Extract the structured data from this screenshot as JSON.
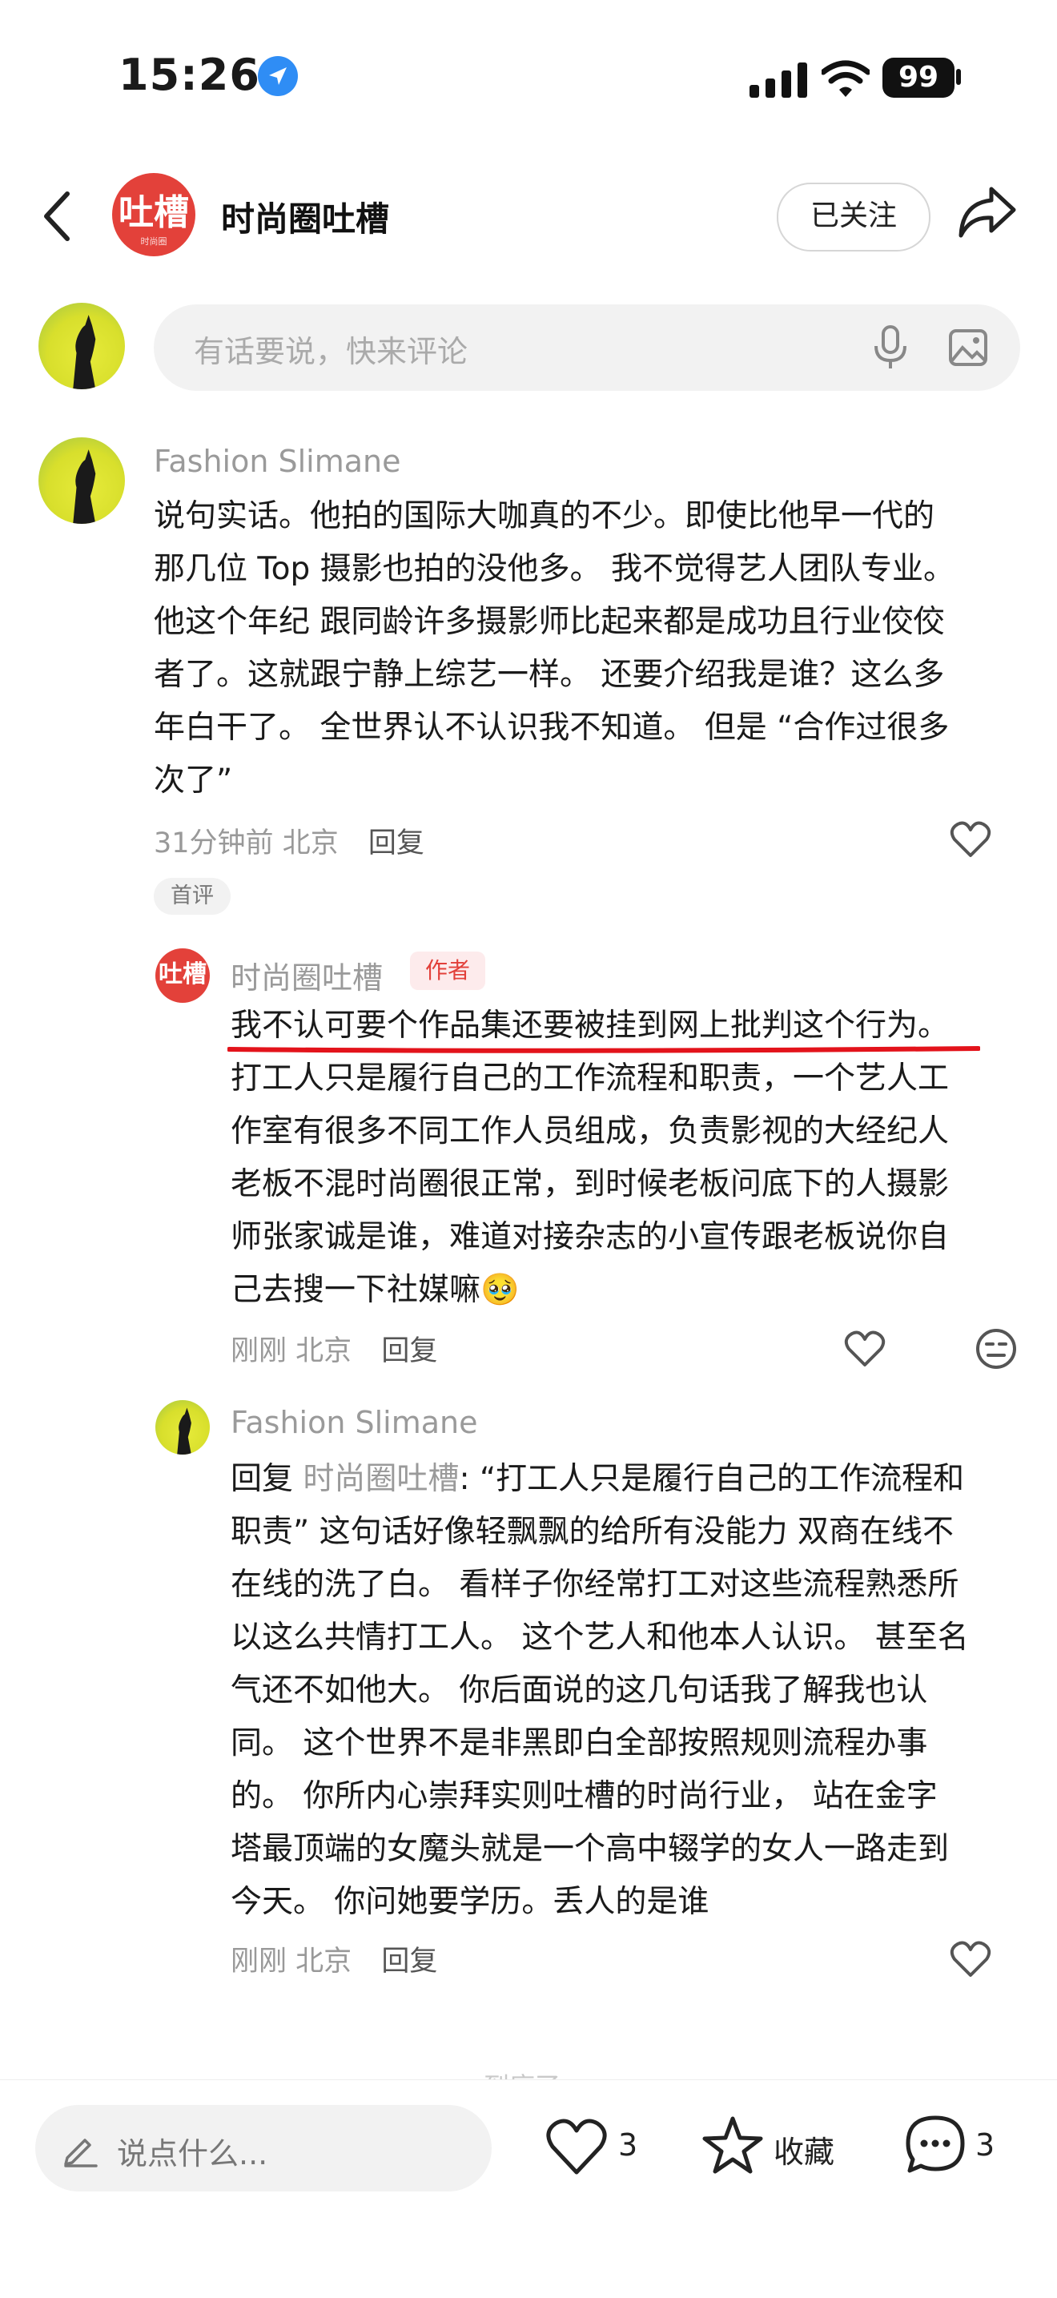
{
  "status_bar": {
    "time": "15:26",
    "battery": "99"
  },
  "header": {
    "account_logo_text": "吐槽",
    "account_logo_small": "时尚圈",
    "account_name": "时尚圈吐槽",
    "follow_label": "已关注"
  },
  "comment_input": {
    "placeholder": "有话要说，快来评论"
  },
  "comments": [
    {
      "author": "Fashion Slimane",
      "lines": [
        "说句实话。他拍的国际大咖真的不少。即使比他早一代的",
        "那几位 Top 摄影也拍的没他多。 我不觉得艺人团队专业。",
        "他这个年纪 跟同龄许多摄影师比起来都是成功且行业佼佼",
        "者了。这就跟宁静上综艺一样。 还要介绍我是谁？这么多",
        "年白干了。 全世界认不认识我不知道。 但是 “合作过很多",
        "次了”"
      ],
      "time": "31分钟前",
      "location": "北京",
      "reply_label": "回复",
      "badge": "首评"
    },
    {
      "author": "时尚圈吐槽",
      "author_badge": "作者",
      "logo_text": "吐槽",
      "lines": [
        "我不认可要个作品集还要被挂到网上批判这个行为。",
        "打工人只是履行自己的工作流程和职责，一个艺人工",
        "作室有很多不同工作人员组成，负责影视的大经纪人",
        "老板不混时尚圈很正常，到时候老板问底下的人摄影",
        "师张家诚是谁，难道对接杂志的小宣传跟老板说你自",
        "己去搜一下社媒嘛"
      ],
      "emoji": "🥹",
      "time": "刚刚",
      "location": "北京",
      "reply_label": "回复"
    },
    {
      "author": "Fashion Slimane",
      "reply_prefix": "回复",
      "reply_to": "时尚圈吐槽",
      "first_line_rest": ": “打工人只是履行自己的工作流程和",
      "lines": [
        "职责” 这句话好像轻飘飘的给所有没能力 双商在线不",
        "在线的洗了白。 看样子你经常打工对这些流程熟悉所",
        "以这么共情打工人。 这个艺人和他本人认识。 甚至名",
        "气还不如他大。 你后面说的这几句话我了解我也认",
        "同。 这个世界不是非黑即白全部按照规则流程办事",
        "的。 你所内心崇拜实则吐槽的时尚行业， 站在金字",
        "塔最顶端的女魔头就是一个高中辍学的女人一路走到",
        "今天。 你问她要学历。丢人的是谁"
      ],
      "time": "刚刚",
      "location": "北京",
      "reply_label": "回复"
    }
  ],
  "partial_text": "到底了",
  "bottom_bar": {
    "input_placeholder": "说点什么...",
    "like_count": "3",
    "favorite_label": "收藏",
    "comment_count": "3"
  },
  "colors": {
    "accent_red": "#e2403a",
    "underline_red": "#e3131b",
    "location_blue": "#2f8df5"
  },
  "icons": [
    "location-arrow-icon",
    "signal-icon",
    "wifi-icon",
    "battery-icon",
    "back-icon",
    "share-icon",
    "microphone-icon",
    "image-icon",
    "heart-icon",
    "neutral-face-icon",
    "pencil-icon",
    "star-icon",
    "chat-bubble-icon"
  ]
}
